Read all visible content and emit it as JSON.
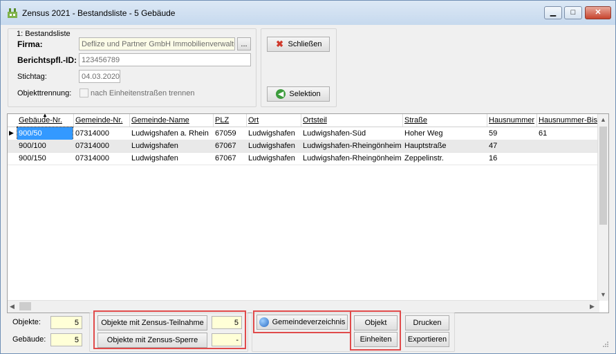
{
  "window": {
    "title": "Zensus 2021 - Bestandsliste - 5 Gebäude",
    "controls": {
      "minimize": "▁",
      "maximize": "□",
      "close": "✕"
    }
  },
  "form": {
    "group_label": "1: Bestandsliste",
    "firma_label": "Firma:",
    "firma_value": "Deflize und Partner GmbH Immobilienverwaltung",
    "firma_browse": "...",
    "berichtspfl_label": "Berichtspfl.-ID:",
    "berichtspfl_value": "123456789",
    "stichtag_label": "Stichtag:",
    "stichtag_value": "04.03.2020",
    "objekttrennung_label": "Objekttrennung:",
    "objekttrennung_option": "nach Einheitenstraßen trennen"
  },
  "actions": {
    "close_label": "Schließen",
    "selection_label": "Selektion"
  },
  "table": {
    "columns": [
      "Gebäude-Nr.",
      "Gemeinde-Nr.",
      "Gemeinde-Name",
      "PLZ",
      "Ort",
      "Ortsteil",
      "Straße",
      "Hausnummer",
      "Hausnummer-Bis"
    ],
    "rows": [
      [
        "900/50",
        "07314000",
        "Ludwigshafen a. Rhein",
        "67059",
        "Ludwigshafen",
        "Ludwigshafen-Süd",
        "Hoher Weg",
        "59",
        "61"
      ],
      [
        "900/100",
        "07314000",
        "Ludwigshafen",
        "67067",
        "Ludwigshafen",
        "Ludwigshafen-Rheingönheim",
        "Hauptstraße",
        "47",
        ""
      ],
      [
        "900/150",
        "07314000",
        "Ludwigshafen",
        "67067",
        "Ludwigshafen",
        "Ludwigshafen-Rheingönheim",
        "Zeppelinstr.",
        "16",
        ""
      ]
    ]
  },
  "footer": {
    "objekte_label": "Objekte:",
    "objekte_count": "5",
    "gebaeude_label": "Gebäude:",
    "gebaeude_count": "5",
    "teilnahme_label": "Objekte mit Zensus-Teilnahme",
    "teilnahme_count": "5",
    "sperre_label": "Objekte mit Zensus-Sperre",
    "sperre_count": "-",
    "gemeinde_label": "Gemeindeverzeichnis",
    "objekt_label": "Objekt",
    "einheiten_label": "Einheiten",
    "drucken_label": "Drucken",
    "exportieren_label": "Exportieren"
  },
  "colors": {
    "highlight": "#e04a4a",
    "selection": "#3399ff"
  }
}
